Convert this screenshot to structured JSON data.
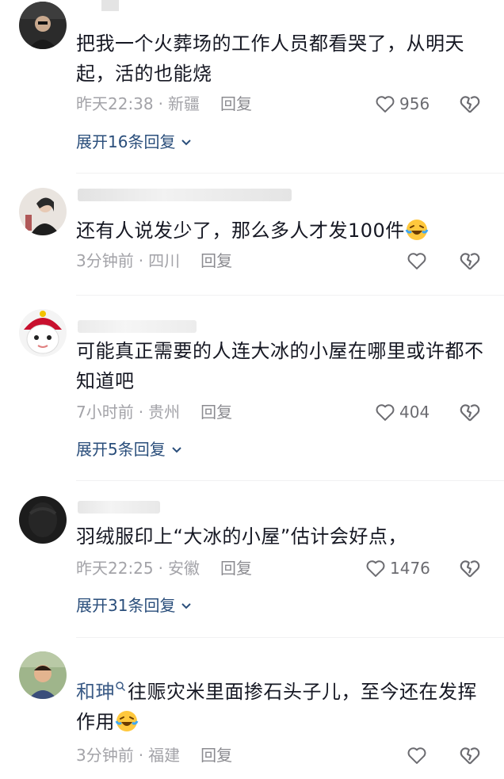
{
  "comments": [
    {
      "text": "把我一个火葬场的工作人员都看哭了，从明天起，活的也能烧",
      "time": "昨天22:38",
      "location": "新疆",
      "reply_label": "回复",
      "likes": "956",
      "expand_label": "展开16条回复"
    },
    {
      "text": "还有人说发少了，那么多人才发100件",
      "emoji": "laughing-crying-emoji",
      "time": "3分钟前",
      "location": "四川",
      "reply_label": "回复",
      "likes": ""
    },
    {
      "text": "可能真正需要的人连大冰的小屋在哪里或许都不知道吧",
      "time": "7小时前",
      "location": "贵州",
      "reply_label": "回复",
      "likes": "404",
      "expand_label": "展开5条回复"
    },
    {
      "text": "羽绒服印上“大冰的小屋”估计会好点，",
      "time": "昨天22:25",
      "location": "安徽",
      "reply_label": "回复",
      "likes": "1476",
      "expand_label": "展开31条回复"
    },
    {
      "author": "和珅",
      "text": "往赈灾米里面掺石头子儿，至今还在发挥作用",
      "emoji": "laughing-crying-emoji",
      "time": "3分钟前",
      "location": "福建",
      "reply_label": "回复",
      "likes": ""
    }
  ],
  "separator": "·",
  "icons": {
    "like": "heart-outline-icon",
    "dislike": "broken-heart-icon",
    "expand": "chevron-down-icon",
    "search_hint": "search-icon"
  },
  "colors": {
    "text": "#161823",
    "meta": "#a3a3a8",
    "link": "#2a4e7b"
  }
}
